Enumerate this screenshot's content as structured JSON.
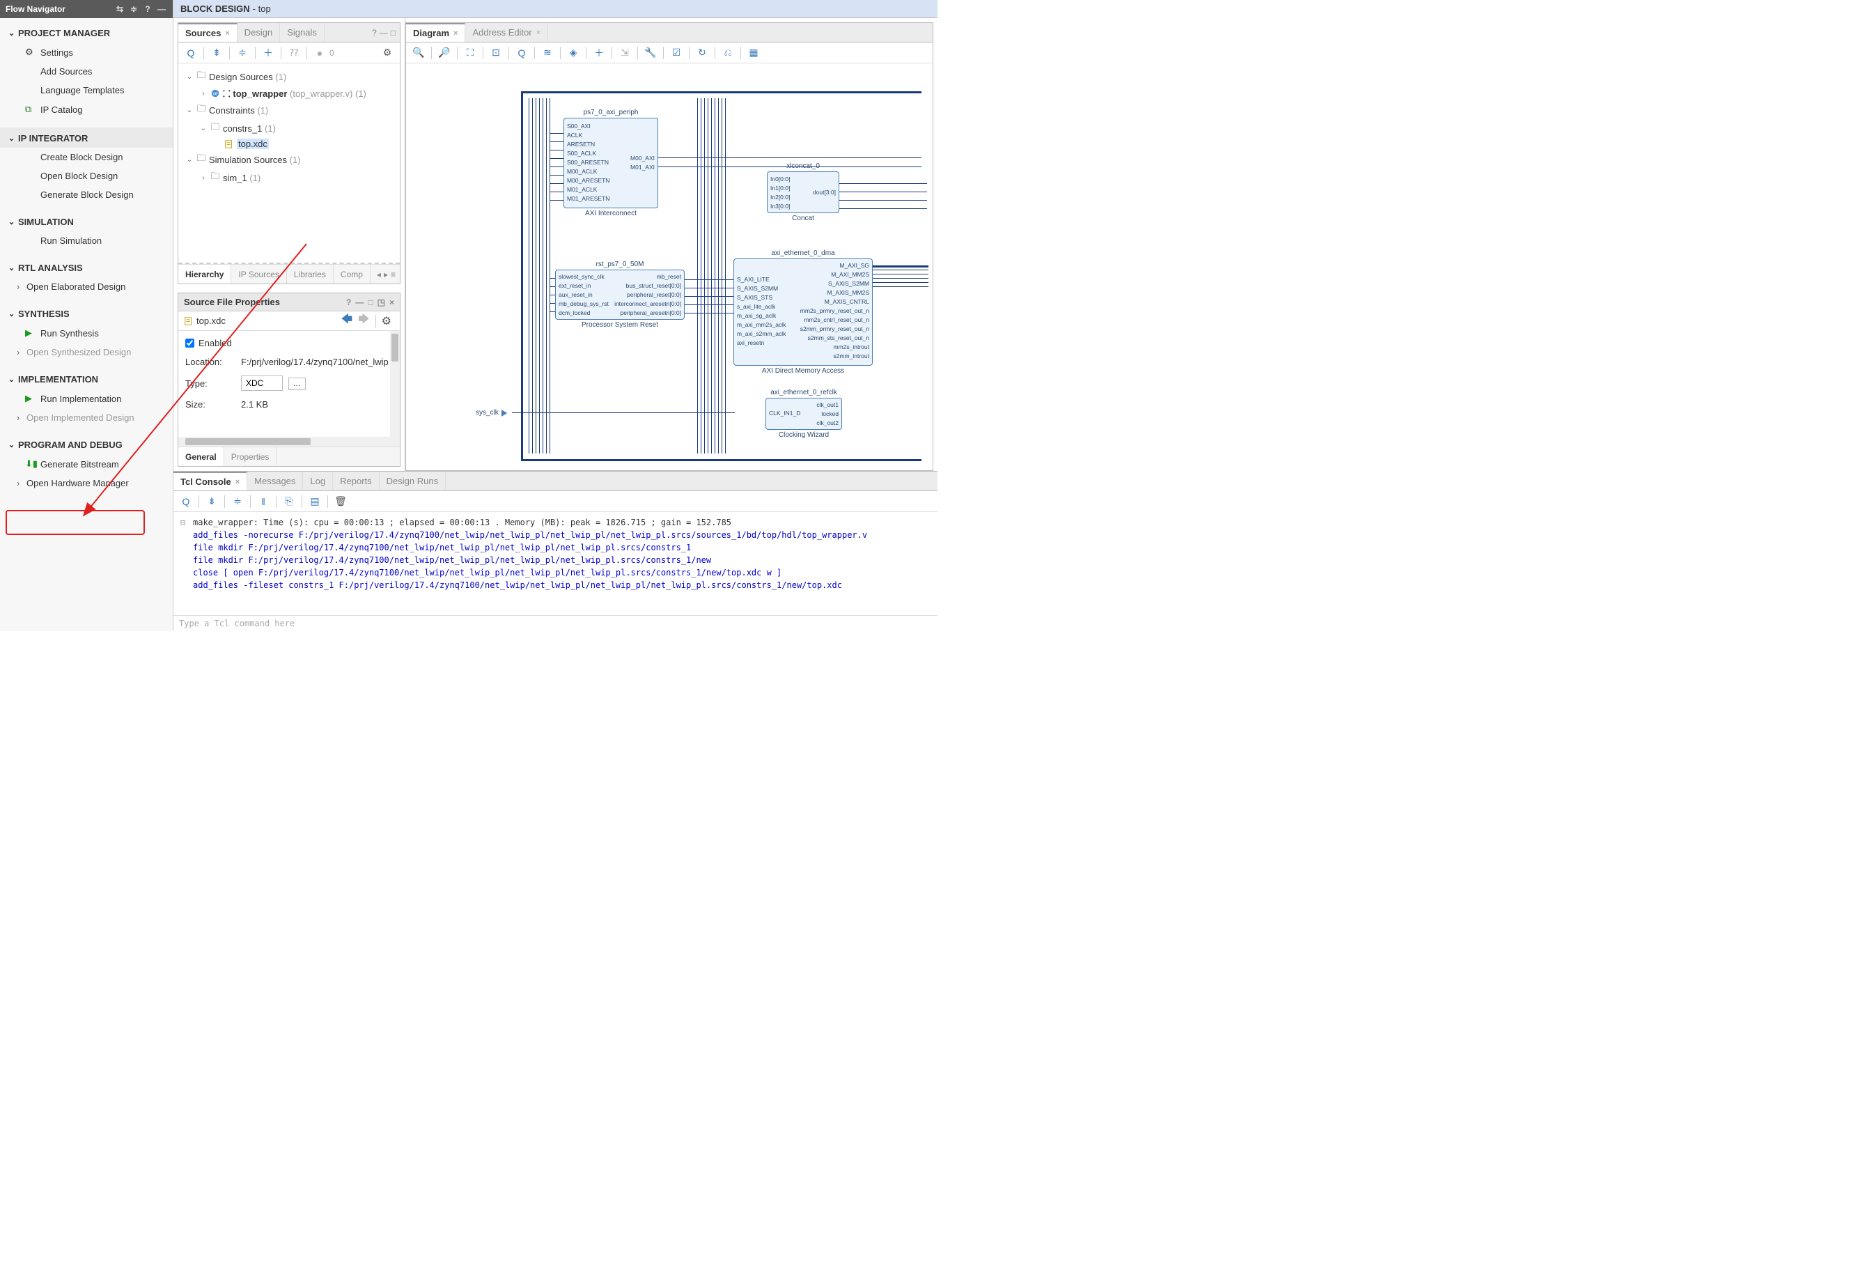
{
  "sidebar": {
    "title": "Flow Navigator",
    "sections": [
      {
        "title": "PROJECT MANAGER",
        "items": [
          {
            "label": "Settings",
            "icon": "gear"
          },
          {
            "label": "Add Sources"
          },
          {
            "label": "Language Templates"
          },
          {
            "label": "IP Catalog",
            "icon": "ip"
          }
        ]
      },
      {
        "title": "IP INTEGRATOR",
        "band": true,
        "items": [
          {
            "label": "Create Block Design"
          },
          {
            "label": "Open Block Design"
          },
          {
            "label": "Generate Block Design"
          }
        ]
      },
      {
        "title": "SIMULATION",
        "items": [
          {
            "label": "Run Simulation"
          }
        ]
      },
      {
        "title": "RTL ANALYSIS",
        "items": [
          {
            "label": "Open Elaborated Design",
            "expand": true
          }
        ]
      },
      {
        "title": "SYNTHESIS",
        "items": [
          {
            "label": "Run Synthesis",
            "icon": "play-green"
          },
          {
            "label": "Open Synthesized Design",
            "expand": true,
            "disabled": true
          }
        ]
      },
      {
        "title": "IMPLEMENTATION",
        "items": [
          {
            "label": "Run Implementation",
            "icon": "play-green"
          },
          {
            "label": "Open Implemented Design",
            "expand": true,
            "disabled": true
          }
        ]
      },
      {
        "title": "PROGRAM AND DEBUG",
        "items": [
          {
            "label": "Generate Bitstream",
            "icon": "bitstream",
            "highlight": true
          },
          {
            "label": "Open Hardware Manager",
            "expand": true
          }
        ]
      }
    ]
  },
  "block_design": {
    "title_prefix": "BLOCK DESIGN",
    "title_suffix": " - top"
  },
  "sources_panel": {
    "tabs": [
      "Sources",
      "Design",
      "Signals"
    ],
    "active_tab": 0,
    "count_badge": "0",
    "tree": {
      "design_sources": {
        "label": "Design Sources",
        "count": "(1)"
      },
      "top_wrapper": {
        "label": "top_wrapper",
        "file": "(top_wrapper.v)",
        "count": "(1)"
      },
      "constraints": {
        "label": "Constraints",
        "count": "(1)"
      },
      "constrs_1": {
        "label": "constrs_1",
        "count": "(1)"
      },
      "top_xdc": {
        "label": "top.xdc"
      },
      "sim_sources": {
        "label": "Simulation Sources",
        "count": "(1)"
      },
      "sim_1": {
        "label": "sim_1",
        "count": "(1)"
      }
    },
    "bottom_tabs": [
      "Hierarchy",
      "IP Sources",
      "Libraries",
      "Comp"
    ],
    "bottom_active": 0
  },
  "props_panel": {
    "title": "Source File Properties",
    "file": "top.xdc",
    "enabled_label": "Enabled",
    "location_label": "Location:",
    "location_value": "F:/prj/verilog/17.4/zynq7100/net_lwip",
    "type_label": "Type:",
    "type_value": "XDC",
    "size_label": "Size:",
    "size_value": "2.1 KB",
    "tabs": [
      "General",
      "Properties"
    ],
    "active_tab": 0
  },
  "diagram_panel": {
    "tabs": [
      "Diagram",
      "Address Editor"
    ],
    "active_tab": 0,
    "ext_port": "sys_clk",
    "blocks": {
      "axi_periph": {
        "title": "ps7_0_axi_periph",
        "footer": "AXI Interconnect",
        "ports_l": [
          "S00_AXI",
          "ACLK",
          "ARESETN",
          "S00_ACLK",
          "S00_ARESETN",
          "M00_ACLK",
          "M00_ARESETN",
          "M01_ACLK",
          "M01_ARESETN"
        ],
        "ports_r": [
          "M00_AXI",
          "M01_AXI"
        ]
      },
      "xlconcat": {
        "title": "xlconcat_0",
        "footer": "Concat",
        "ports_l": [
          "In0[0:0]",
          "In1[0:0]",
          "In2[0:0]",
          "In3[0:0]"
        ],
        "ports_r": [
          "dout[3:0]"
        ]
      },
      "rst": {
        "title": "rst_ps7_0_50M",
        "footer": "Processor System Reset",
        "ports_l": [
          "slowest_sync_clk",
          "ext_reset_in",
          "aux_reset_in",
          "mb_debug_sys_rst",
          "dcm_locked"
        ],
        "ports_r": [
          "mb_reset",
          "bus_struct_reset[0:0]",
          "peripheral_reset[0:0]",
          "interconnect_aresetn[0:0]",
          "peripheral_aresetn[0:0]"
        ]
      },
      "dma": {
        "title": "axi_ethernet_0_dma",
        "footer": "AXI Direct Memory Access",
        "ports_l": [
          "S_AXI_LITE",
          "S_AXIS_S2MM",
          "S_AXIS_STS",
          "s_axi_lite_aclk",
          "m_axi_sg_aclk",
          "m_axi_mm2s_aclk",
          "m_axi_s2mm_aclk",
          "axi_resetn"
        ],
        "ports_r": [
          "M_AXI_SG",
          "M_AXI_MM2S",
          "S_AXIS_S2MM",
          "M_AXIS_MM2S",
          "M_AXIS_CNTRL",
          "mm2s_prmry_reset_out_n",
          "mm2s_cntrl_reset_out_n",
          "s2mm_prmry_reset_out_n",
          "s2mm_sts_reset_out_n",
          "mm2s_introut",
          "s2mm_introut"
        ]
      },
      "refclk": {
        "title": "axi_ethernet_0_refclk",
        "footer": "Clocking Wizard",
        "ports_l": [
          "CLK_IN1_D"
        ],
        "ports_r": [
          "clk_out1",
          "locked",
          "clk_out2"
        ]
      }
    }
  },
  "tcl_panel": {
    "tabs": [
      "Tcl Console",
      "Messages",
      "Log",
      "Reports",
      "Design Runs"
    ],
    "active_tab": 0,
    "lines": [
      {
        "t": "out",
        "text": "make_wrapper: Time (s): cpu = 00:00:13 ; elapsed = 00:00:13 . Memory (MB): peak = 1826.715 ; gain = 152.785"
      },
      {
        "t": "cmd",
        "text": "add_files -norecurse F:/prj/verilog/17.4/zynq7100/net_lwip/net_lwip_pl/net_lwip_pl/net_lwip_pl.srcs/sources_1/bd/top/hdl/top_wrapper.v"
      },
      {
        "t": "cmd",
        "text": "file mkdir F:/prj/verilog/17.4/zynq7100/net_lwip/net_lwip_pl/net_lwip_pl/net_lwip_pl.srcs/constrs_1"
      },
      {
        "t": "cmd",
        "text": "file mkdir F:/prj/verilog/17.4/zynq7100/net_lwip/net_lwip_pl/net_lwip_pl/net_lwip_pl.srcs/constrs_1/new"
      },
      {
        "t": "cmd",
        "text": "close [ open F:/prj/verilog/17.4/zynq7100/net_lwip/net_lwip_pl/net_lwip_pl/net_lwip_pl.srcs/constrs_1/new/top.xdc w ]"
      },
      {
        "t": "cmd",
        "text": "add_files -fileset constrs_1 F:/prj/verilog/17.4/zynq7100/net_lwip/net_lwip_pl/net_lwip_pl/net_lwip_pl.srcs/constrs_1/new/top.xdc"
      }
    ],
    "input_placeholder": "Type a Tcl command here"
  }
}
